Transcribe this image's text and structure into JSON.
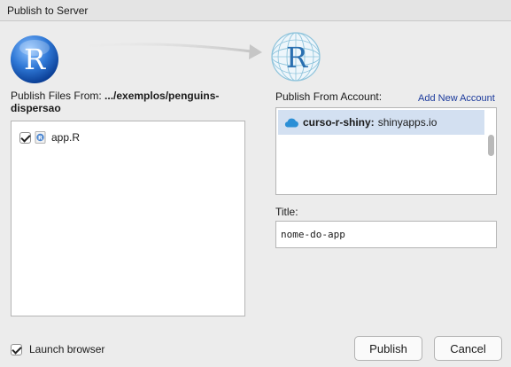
{
  "window": {
    "title": "Publish to Server"
  },
  "publish_files": {
    "label_prefix": "Publish Files From: ",
    "path": ".../exemplos/penguins-dispersao",
    "files": [
      {
        "name": "app.R",
        "checked": true,
        "icon": "r-file-icon"
      }
    ]
  },
  "account": {
    "label": "Publish From Account:",
    "add_link": "Add New Account",
    "items": [
      {
        "name": "curso-r-shiny:",
        "server": "shinyapps.io",
        "icon": "cloud-icon",
        "selected": true
      }
    ]
  },
  "title_field": {
    "label": "Title:",
    "value": "nome-do-app"
  },
  "launch_browser": {
    "label": "Launch browser",
    "checked": true
  },
  "buttons": {
    "publish": "Publish",
    "cancel": "Cancel"
  },
  "colors": {
    "selection": "#d3e0f1",
    "link": "#1b3a9c",
    "r_blue": "#276dc3"
  }
}
